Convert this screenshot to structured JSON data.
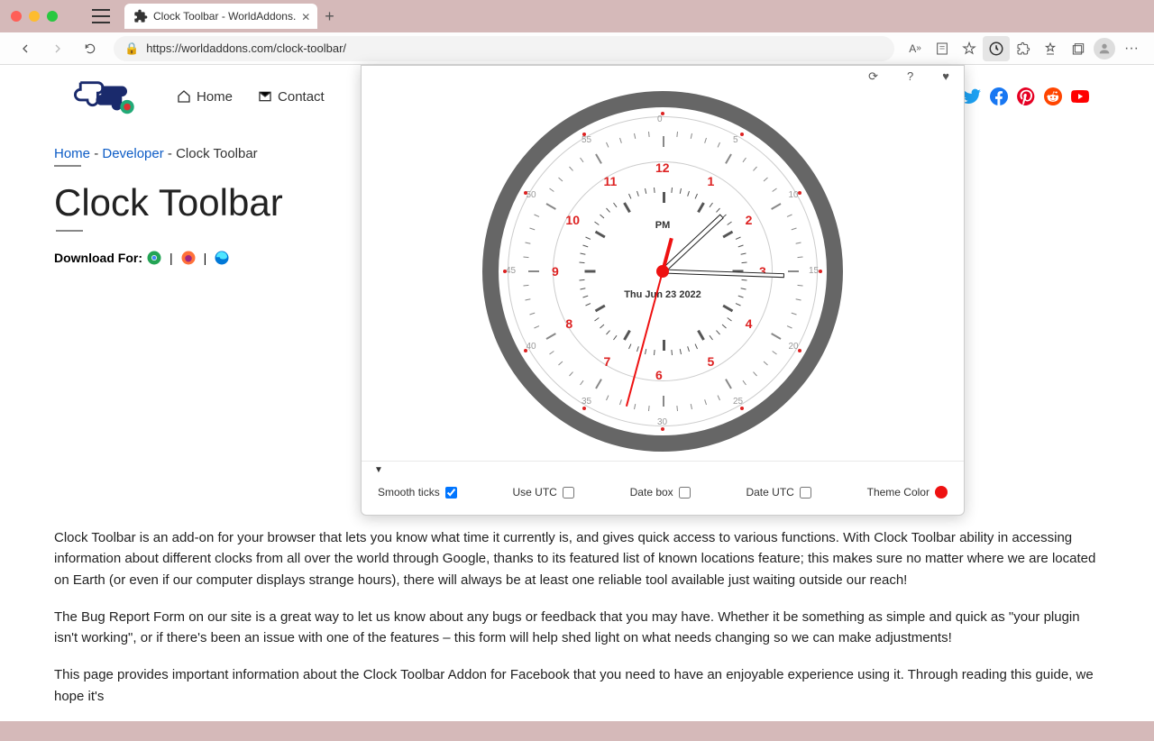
{
  "browser": {
    "tab_title": "Clock Toolbar - WorldAddons.",
    "url": "https://worldaddons.com/clock-toolbar/"
  },
  "nav": {
    "home": "Home",
    "contact": "Contact"
  },
  "breadcrumb": {
    "home": "Home",
    "developer": "Developer",
    "current": "Clock Toolbar"
  },
  "page": {
    "title": "Clock Toolbar",
    "download_label": "Download For:",
    "p1": "Clock Toolbar is an add-on for your browser that lets you know what time it currently is, and gives quick access to various functions. With Clock Toolbar ability in accessing information about different clocks from all over the world through Google, thanks to its featured list of known locations feature; this makes sure no matter where we are located on Earth (or even if our computer displays strange hours), there will always be at least one reliable tool available just waiting outside our reach!",
    "p2": "The Bug Report Form on our site is a great way to let us know about any bugs or feedback that you may have. Whether it be something as simple and quick as \"your plugin isn't working\", or if there's been an issue with one of the features – this form will help shed light on what needs changing so we can make adjustments!",
    "p3": "This page provides important information about the Clock Toolbar Addon for Facebook that you need to have an enjoyable experience using it. Through reading this guide, we hope it's"
  },
  "clock": {
    "ampm": "PM",
    "date": "Thu Jun 23 2022",
    "hours": [
      "12",
      "1",
      "2",
      "3",
      "4",
      "5",
      "6",
      "7",
      "8",
      "9",
      "10",
      "11"
    ],
    "outer": [
      "0",
      "5",
      "10",
      "15",
      "20",
      "25",
      "30",
      "35",
      "40",
      "45",
      "50",
      "55"
    ]
  },
  "popup_options": {
    "smooth": "Smooth ticks",
    "utc": "Use UTC",
    "datebox": "Date box",
    "dateutc": "Date UTC",
    "theme": "Theme Color",
    "smooth_checked": true,
    "utc_checked": false,
    "datebox_checked": false,
    "dateutc_checked": false
  }
}
